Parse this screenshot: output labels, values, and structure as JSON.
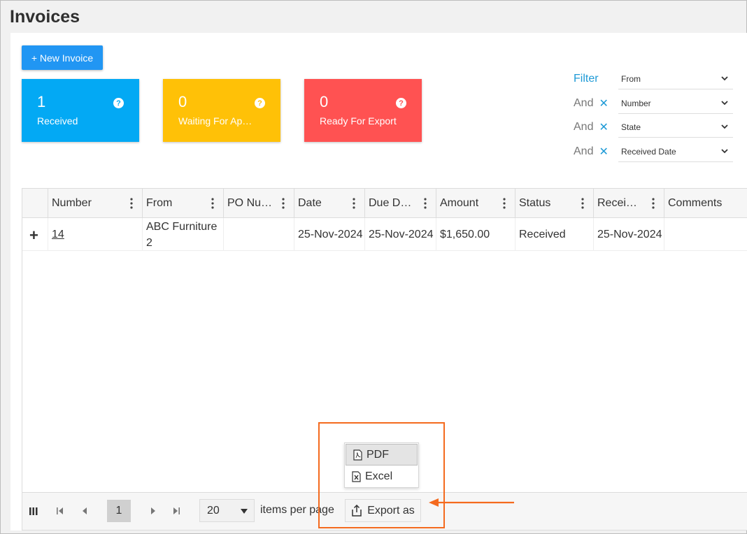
{
  "page": {
    "title": "Invoices"
  },
  "toolbar": {
    "new_invoice_label": "+ New Invoice"
  },
  "cards": [
    {
      "count": "1",
      "label": "Received",
      "color": "#03a9f4"
    },
    {
      "count": "0",
      "label": "Waiting For Approval",
      "color": "#ffc107"
    },
    {
      "count": "0",
      "label": "Ready For Export",
      "color": "#ff5252"
    }
  ],
  "help_glyph": "?",
  "filter": {
    "title": "Filter",
    "and_label": "And",
    "remove_glyph": "✕",
    "fields": [
      "From",
      "Number",
      "State",
      "Received Date"
    ]
  },
  "grid": {
    "columns": [
      "Number",
      "From",
      "PO Number",
      "Date",
      "Due Date",
      "Amount",
      "Status",
      "Received Date",
      "Comments"
    ],
    "column_display": [
      "Number",
      "From",
      "PO Nu…",
      "Date",
      "Due D…",
      "Amount",
      "Status",
      "Recei…",
      "Comments"
    ],
    "rows": [
      {
        "expand": "+",
        "number": "14",
        "from_line1": "ABC Furniture",
        "from_line2": "2",
        "po_number": "",
        "date": "25-Nov-2024",
        "due_date": "25-Nov-2024",
        "amount": "$1,650.00",
        "status": "Received",
        "received_date": "25-Nov-2024",
        "comments": ""
      }
    ]
  },
  "pager": {
    "current_page": "1",
    "page_size": "20",
    "items_per_page_label": "items per page",
    "export_label": "Export as"
  },
  "export_menu": {
    "items": [
      "PDF",
      "Excel"
    ]
  },
  "colors": {
    "accent": "#2196f3",
    "annotation": "#f46a1e",
    "link": "#1e9ad6"
  }
}
